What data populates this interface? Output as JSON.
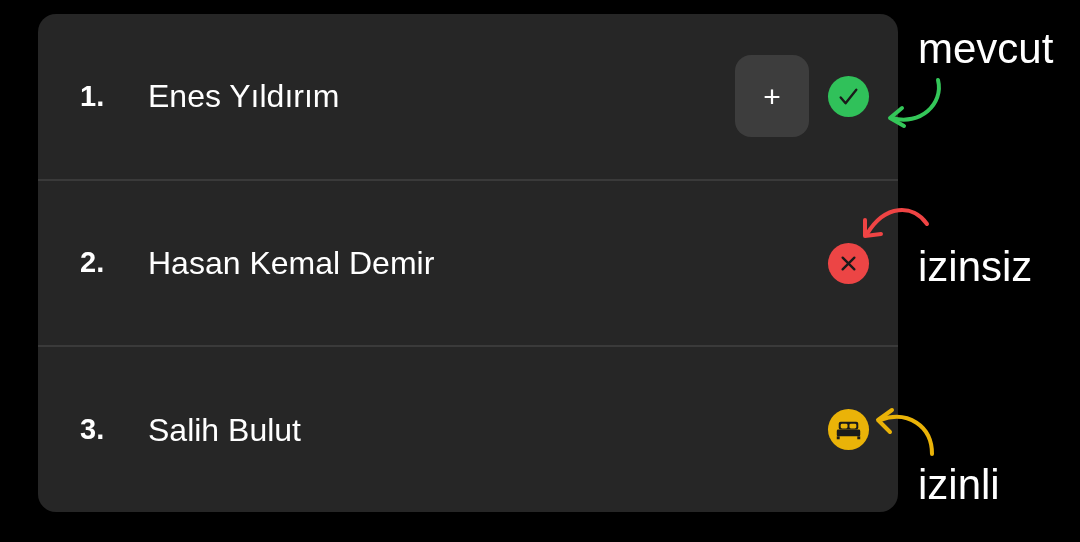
{
  "rows": [
    {
      "number": "1.",
      "name": "Enes Yıldırım",
      "add_button": "+",
      "kind": "present"
    },
    {
      "number": "2.",
      "name": "Hasan Kemal Demir",
      "kind": "absent"
    },
    {
      "number": "3.",
      "name": "Salih Bulut",
      "kind": "leave"
    }
  ],
  "annotations": [
    {
      "label": "mevcut",
      "color": "#34c759"
    },
    {
      "label": "izinsiz",
      "color": "#ef4444"
    },
    {
      "label": "izinli",
      "color": "#eab308"
    }
  ]
}
